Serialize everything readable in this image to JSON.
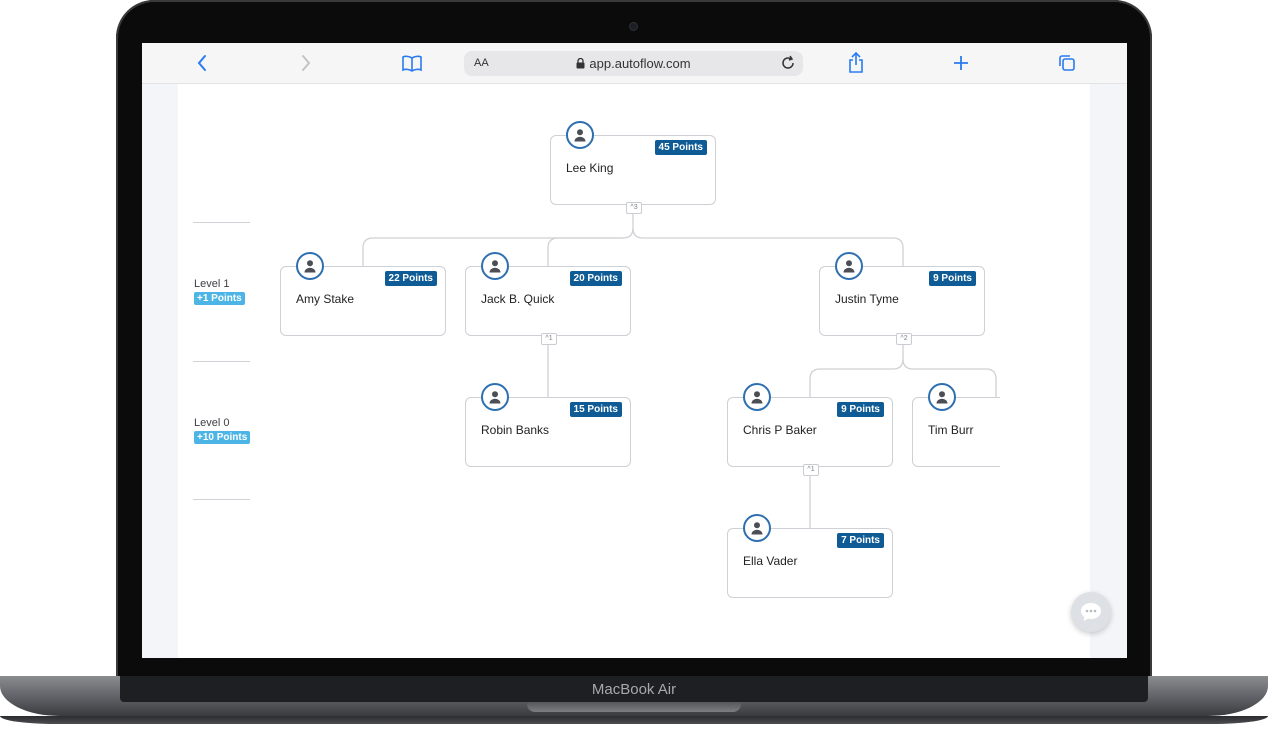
{
  "device": {
    "brand_label": "MacBook Air"
  },
  "browser": {
    "address_aa": "AA",
    "url": "app.autoflow.com"
  },
  "levels": [
    {
      "label": "Level 1",
      "badge": "+1 Points"
    },
    {
      "label": "Level 0",
      "badge": "+10 Points"
    }
  ],
  "nodes": {
    "lee_king": {
      "name": "Lee King",
      "points": "45 Points",
      "children_count": "3"
    },
    "amy_stake": {
      "name": "Amy Stake",
      "points": "22 Points"
    },
    "jack_quick": {
      "name": "Jack B. Quick",
      "points": "20 Points",
      "children_count": "1"
    },
    "justin_tyme": {
      "name": "Justin Tyme",
      "points": "9 Points",
      "children_count": "2"
    },
    "robin_banks": {
      "name": "Robin Banks",
      "points": "15 Points"
    },
    "chris_baker": {
      "name": "Chris P Baker",
      "points": "9 Points",
      "children_count": "1"
    },
    "tim_burr": {
      "name": "Tim Burr"
    },
    "ella_vader": {
      "name": "Ella Vader",
      "points": "7 Points"
    }
  },
  "colors": {
    "accent": "#2a7bf1",
    "points_badge": "#0e5b96",
    "level_badge": "#4cb5e5",
    "avatar_ring": "#2d6fb0"
  }
}
